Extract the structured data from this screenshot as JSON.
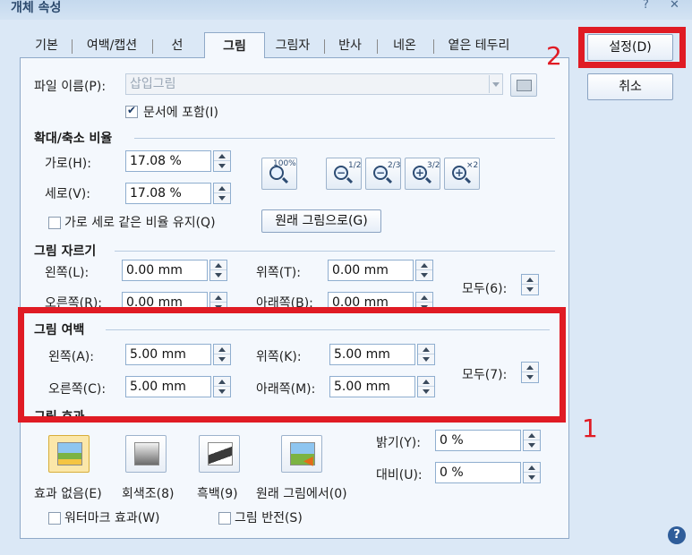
{
  "window": {
    "title": "개체 속성",
    "help_glyph": "?",
    "close_glyph": "✕"
  },
  "tabs": [
    {
      "label": "기본"
    },
    {
      "label": "여백/캡션"
    },
    {
      "label": "선"
    },
    {
      "label": "그림"
    },
    {
      "label": "그림자"
    },
    {
      "label": "반사"
    },
    {
      "label": "네온"
    },
    {
      "label": "옅은 테두리"
    }
  ],
  "buttons": {
    "ok_label": "설정(D)",
    "cancel_label": "취소",
    "original_size_label": "원래 그림으로(G)"
  },
  "file": {
    "label": "파일 이름(P):",
    "value": "삽입그림",
    "embed_label": "문서에 포함(I)",
    "embed_checked": true
  },
  "scale": {
    "section_title": "확대/축소 비율",
    "horizontal_label": "가로(H):",
    "horizontal_value": "17.08 %",
    "vertical_label": "세로(V):",
    "vertical_value": "17.08 %",
    "keep_ratio_label": "가로 세로 같은 비율 유지(Q)",
    "keep_ratio_checked": false,
    "zoom_buttons": [
      {
        "icon": "zoom-100-icon",
        "label": "100%"
      },
      {
        "icon": "zoom-out-half-icon",
        "label": "1/2"
      },
      {
        "icon": "zoom-out-two-thirds-icon",
        "label": "2/3"
      },
      {
        "icon": "zoom-in-three-halves-icon",
        "label": "3/2"
      },
      {
        "icon": "zoom-in-double-icon",
        "label": "×2"
      }
    ]
  },
  "crop": {
    "section_title": "그림 자르기",
    "left_label": "왼쪽(L):",
    "left_value": "0.00 mm",
    "top_label": "위쪽(T):",
    "top_value": "0.00 mm",
    "right_label": "오른쪽(R):",
    "right_value": "0.00 mm",
    "bottom_label": "아래쪽(B):",
    "bottom_value": "0.00 mm",
    "all_label": "모두(6):"
  },
  "margin": {
    "section_title": "그림 여백",
    "left_label": "왼쪽(A):",
    "left_value": "5.00 mm",
    "top_label": "위쪽(K):",
    "top_value": "5.00 mm",
    "right_label": "오른쪽(C):",
    "right_value": "5.00 mm",
    "bottom_label": "아래쪽(M):",
    "bottom_value": "5.00 mm",
    "all_label": "모두(7):"
  },
  "effects": {
    "section_title": "그림 효과",
    "options": [
      {
        "label": "효과 없음(E)",
        "selected": true
      },
      {
        "label": "회색조(8)",
        "selected": false
      },
      {
        "label": "흑백(9)",
        "selected": false
      },
      {
        "label": "원래 그림에서(0)",
        "selected": false
      }
    ],
    "brightness_label": "밝기(Y):",
    "brightness_value": "0 %",
    "contrast_label": "대비(U):",
    "contrast_value": "0 %",
    "watermark_label": "워터마크 효과(W)",
    "watermark_checked": false,
    "invert_label": "그림 반전(S)",
    "invert_checked": false
  },
  "annotations": {
    "marker_1": "1",
    "marker_2": "2",
    "highlight_color": "#e01b24"
  }
}
